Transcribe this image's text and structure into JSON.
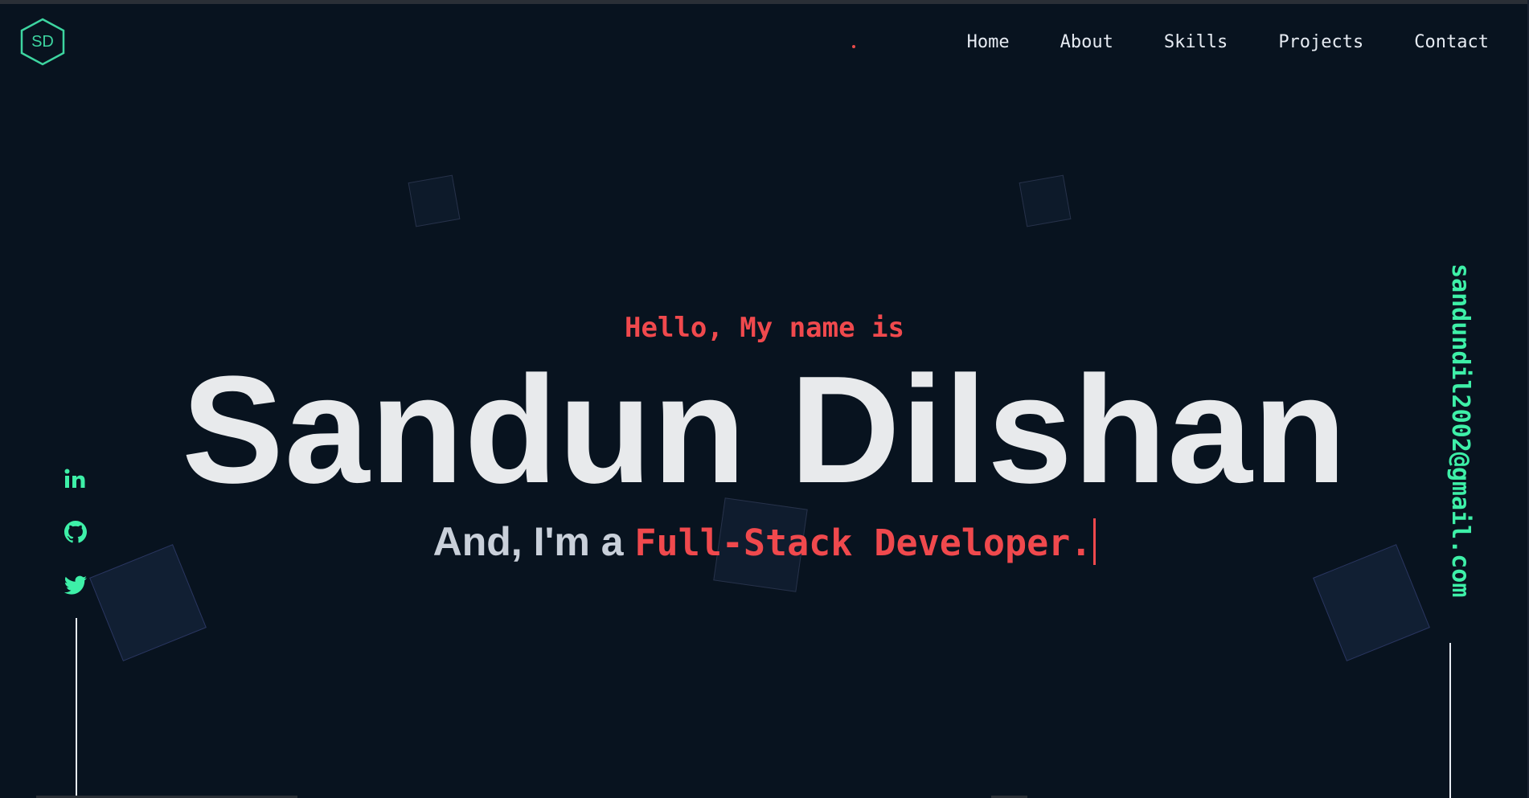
{
  "logo": {
    "text": "SD"
  },
  "nav": {
    "items": [
      "Home",
      "About",
      "Skills",
      "Projects",
      "Contact"
    ]
  },
  "hero": {
    "greeting": "Hello, My name is",
    "name": "Sandun Dilshan",
    "role_prefix": "And, I'm a ",
    "role_typed": "Full-Stack Developer."
  },
  "socials": {
    "icons": [
      "linkedin-icon",
      "github-icon",
      "twitter-icon"
    ]
  },
  "contact": {
    "email": "sandundil2002@gmail.com"
  },
  "colors": {
    "background": "#08131f",
    "accent_red": "#f0494d",
    "accent_green": "#3ef0a8",
    "text_light": "#e8eaec"
  }
}
